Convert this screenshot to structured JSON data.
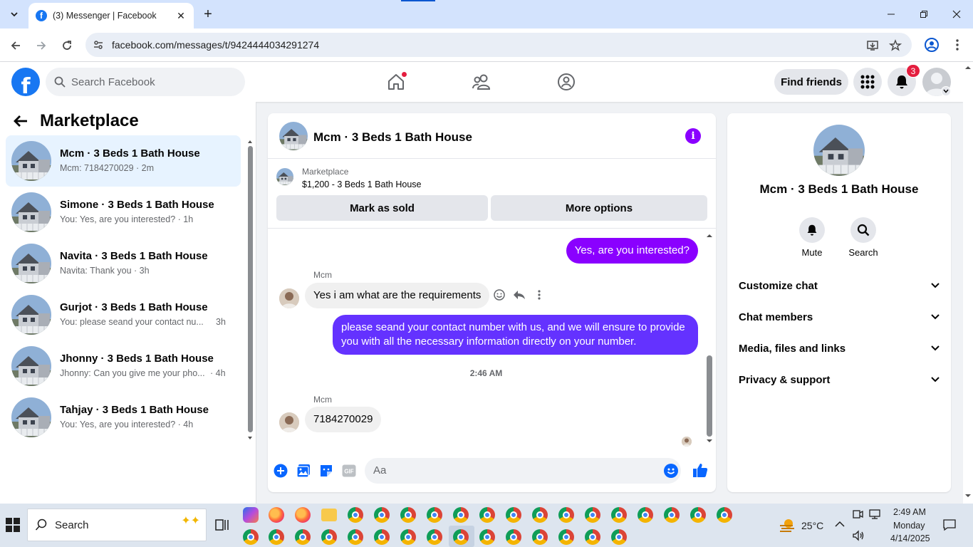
{
  "browser": {
    "tab_title": "(3) Messenger | Facebook",
    "url": "facebook.com/messages/t/9424444034291274"
  },
  "fb": {
    "search_placeholder": "Search Facebook",
    "find_friends": "Find friends",
    "notification_count": "3",
    "brand_color": "#1877f2",
    "accent_color": "#8a00ff"
  },
  "sidebar": {
    "title": "Marketplace",
    "conversations": [
      {
        "name": "Mcm · 3 Beds 1 Bath House",
        "preview": "Mcm: 7184270029 · 2m",
        "active": true
      },
      {
        "name": "Simone · 3 Beds 1 Bath House",
        "preview": "You: Yes, are you interested? · 1h"
      },
      {
        "name": "Navita · 3 Beds 1 Bath House",
        "preview": "Navita: Thank you · 3h"
      },
      {
        "name": "Gurjot · 3 Beds 1 Bath House",
        "preview": "You: please seand your contact nu...",
        "time": "3h"
      },
      {
        "name": "Jhonny · 3 Beds 1 Bath House",
        "preview": "Jhonny: Can you give me your pho...",
        "time": "· 4h"
      },
      {
        "name": "Tahjay · 3 Beds 1 Bath House",
        "preview": "You: Yes, are you interested? · 4h"
      }
    ]
  },
  "chat": {
    "title": "Mcm · 3 Beds 1 Bath House",
    "listing_source": "Marketplace",
    "listing_price": "$1,200 - 3 Beds 1 Bath House",
    "mark_sold": "Mark as sold",
    "more_options": "More options",
    "messages": {
      "out1": "Yes, are you interested?",
      "sender1": "Mcm",
      "in1": "Yes i am what are the requirements",
      "out2": "please seand your contact number with us, and we will ensure to provide you with all the necessary information directly on your number.",
      "timestamp": "2:46 AM",
      "sender2": "Mcm",
      "in2": "7184270029"
    },
    "composer_placeholder": "Aa"
  },
  "info": {
    "name": "Mcm · 3 Beds 1 Bath House",
    "mute": "Mute",
    "search": "Search",
    "rows": [
      "Customize chat",
      "Chat members",
      "Media, files and links",
      "Privacy & support"
    ]
  },
  "taskbar": {
    "search_placeholder": "Search",
    "weather": "25°C",
    "time": "2:49 AM",
    "day": "Monday",
    "date": "4/14/2025"
  }
}
